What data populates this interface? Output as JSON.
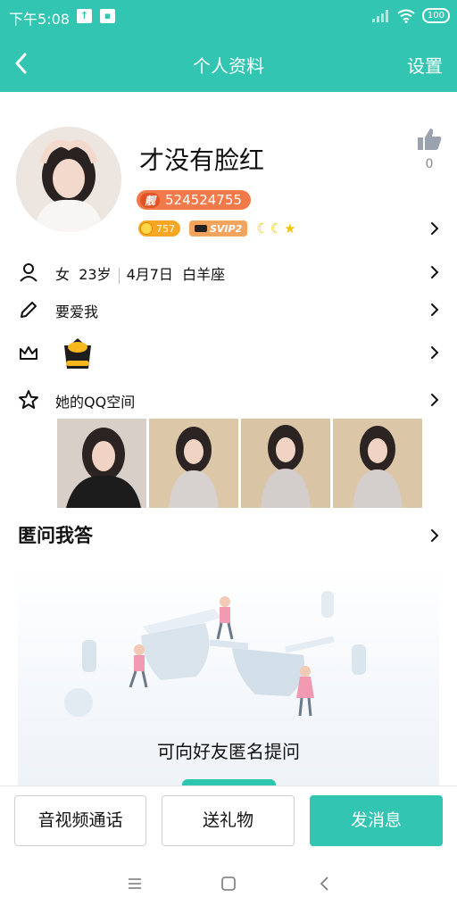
{
  "status": {
    "time": "下午5:08",
    "battery": "100"
  },
  "header": {
    "title": "个人资料",
    "settings": "设置"
  },
  "profile": {
    "name": "才没有脸红",
    "liang_tag": "靓",
    "qq_number": "524524755",
    "coin_value": "757",
    "svip": "SVIP2",
    "likes": "0"
  },
  "rows": {
    "gender": "女",
    "age": "23岁",
    "birthday": "4月7日",
    "zodiac": "白羊座",
    "signature": "要爱我",
    "qzone": "她的QQ空间"
  },
  "anon": {
    "title": "匿问我答",
    "prompt": "可向好友匿名提问"
  },
  "actions": {
    "call": "音视频通话",
    "gift": "送礼物",
    "message": "发消息"
  },
  "colors": {
    "accent": "#31c5b2",
    "badge": "#f27a4a"
  }
}
